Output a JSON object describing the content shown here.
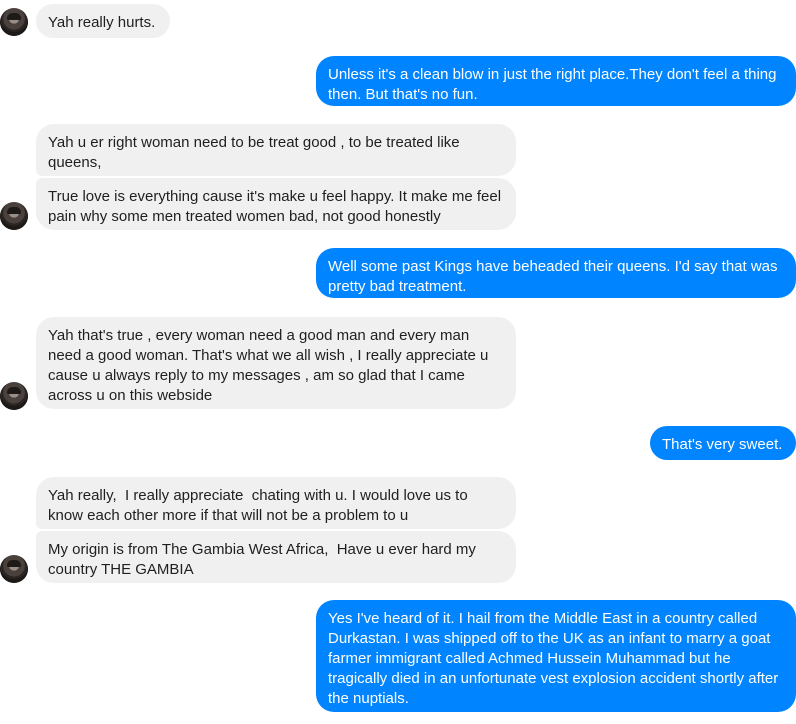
{
  "messages": [
    {
      "side": "incoming",
      "text": "Yah really hurts."
    },
    {
      "side": "outgoing",
      "text": "Unless it's a clean blow in just the right place.They don't feel a thing then. But that's no fun."
    },
    {
      "side": "incoming",
      "text": "Yah u er right woman need to be treat good , to be treated like queens,"
    },
    {
      "side": "incoming",
      "text": "True love is everything cause it's make u feel happy. It make me feel pain why some men treated women bad, not good honestly"
    },
    {
      "side": "outgoing",
      "text": "Well some past Kings have beheaded their queens. I'd say that was pretty bad treatment."
    },
    {
      "side": "incoming",
      "text": "Yah that's true , every woman need a good man and every man need a good woman. That's what we all wish , I really appreciate u cause u always reply to my messages , am so glad that I came across u on this webside"
    },
    {
      "side": "outgoing",
      "text": "That's very sweet."
    },
    {
      "side": "incoming",
      "text": "Yah really,  I really appreciate  chating with u. I would love us to know each other more if that will not be a problem to u"
    },
    {
      "side": "incoming",
      "text": "My origin is from The Gambia West Africa,  Have u ever hard my country THE GAMBIA"
    },
    {
      "side": "outgoing",
      "text": "Yes I've heard of it. I hail from the Middle East in a country called Durkastan. I was shipped off to the UK as an infant to marry a goat farmer immigrant called Achmed Hussein Muhammad but he tragically died in an unfortunate vest explosion accident shortly after the nuptials."
    }
  ],
  "colors": {
    "incoming_bg": "#f1f0f0",
    "outgoing_bg": "#0084ff",
    "incoming_text": "#1f1f1f",
    "outgoing_text": "#ffffff"
  },
  "icons": {
    "avatar": "contact-avatar-icon"
  }
}
